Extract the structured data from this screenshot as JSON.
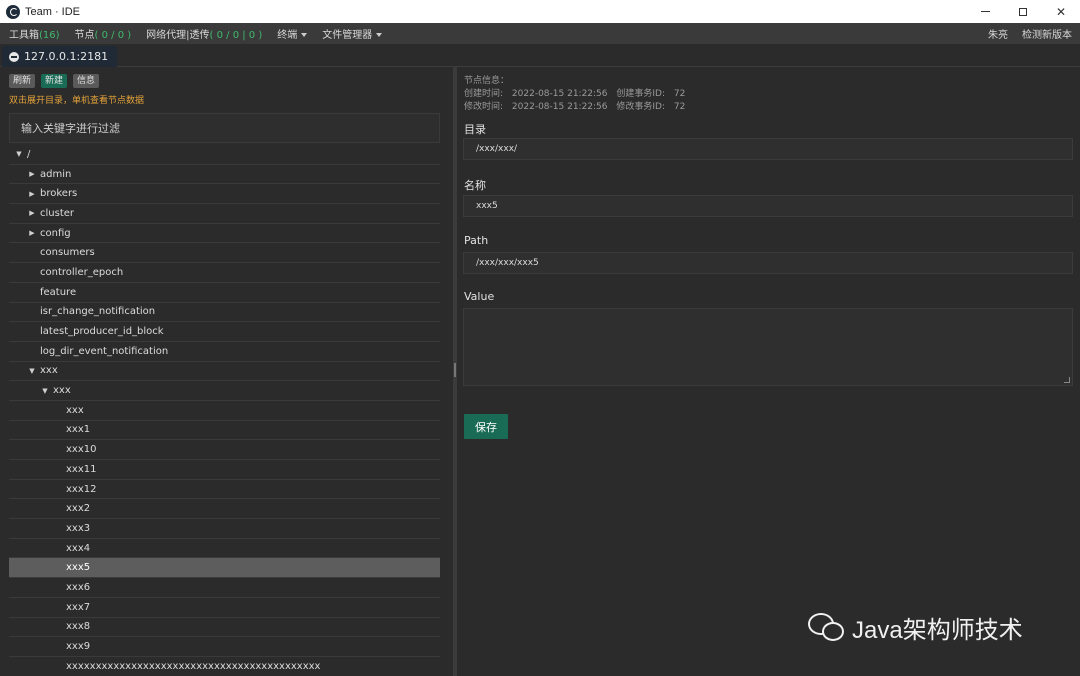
{
  "window": {
    "title": "Team · IDE"
  },
  "menu": {
    "toolbox_label": "工具箱",
    "toolbox_count": "(16)",
    "nodes_label": "节点",
    "nodes_count": "( 0 / 0 )",
    "proxy_label": "网络代理|透传",
    "proxy_count": "( 0 / 0 | 0 )",
    "terminal_label": "终端",
    "file_manager_label": "文件管理器",
    "user_label": "朱亮",
    "check_update_label": "检测新版本"
  },
  "tab": {
    "label": "127.0.0.1:2181"
  },
  "left": {
    "buttons": {
      "refresh": "刷新",
      "new": "新建",
      "info": "信息"
    },
    "hint": "双击展开目录，单机查看节点数据",
    "filter_placeholder": "输入关键字进行过滤",
    "tree": [
      {
        "label": "/",
        "depth": 0,
        "state": "expanded",
        "selected": false
      },
      {
        "label": "admin",
        "depth": 1,
        "state": "collapsed",
        "selected": false
      },
      {
        "label": "brokers",
        "depth": 1,
        "state": "collapsed",
        "selected": false
      },
      {
        "label": "cluster",
        "depth": 1,
        "state": "collapsed",
        "selected": false
      },
      {
        "label": "config",
        "depth": 1,
        "state": "collapsed",
        "selected": false
      },
      {
        "label": "consumers",
        "depth": 1,
        "state": "leaf",
        "selected": false
      },
      {
        "label": "controller_epoch",
        "depth": 1,
        "state": "leaf",
        "selected": false
      },
      {
        "label": "feature",
        "depth": 1,
        "state": "leaf",
        "selected": false
      },
      {
        "label": "isr_change_notification",
        "depth": 1,
        "state": "leaf",
        "selected": false
      },
      {
        "label": "latest_producer_id_block",
        "depth": 1,
        "state": "leaf",
        "selected": false
      },
      {
        "label": "log_dir_event_notification",
        "depth": 1,
        "state": "leaf",
        "selected": false
      },
      {
        "label": "xxx",
        "depth": 1,
        "state": "expanded",
        "selected": false
      },
      {
        "label": "xxx",
        "depth": 2,
        "state": "expanded",
        "selected": false
      },
      {
        "label": "xxx",
        "depth": 3,
        "state": "leaf",
        "selected": false
      },
      {
        "label": "xxx1",
        "depth": 3,
        "state": "leaf",
        "selected": false
      },
      {
        "label": "xxx10",
        "depth": 3,
        "state": "leaf",
        "selected": false
      },
      {
        "label": "xxx11",
        "depth": 3,
        "state": "leaf",
        "selected": false
      },
      {
        "label": "xxx12",
        "depth": 3,
        "state": "leaf",
        "selected": false
      },
      {
        "label": "xxx2",
        "depth": 3,
        "state": "leaf",
        "selected": false
      },
      {
        "label": "xxx3",
        "depth": 3,
        "state": "leaf",
        "selected": false
      },
      {
        "label": "xxx4",
        "depth": 3,
        "state": "leaf",
        "selected": false
      },
      {
        "label": "xxx5",
        "depth": 3,
        "state": "leaf",
        "selected": true
      },
      {
        "label": "xxx6",
        "depth": 3,
        "state": "leaf",
        "selected": false
      },
      {
        "label": "xxx7",
        "depth": 3,
        "state": "leaf",
        "selected": false
      },
      {
        "label": "xxx8",
        "depth": 3,
        "state": "leaf",
        "selected": false
      },
      {
        "label": "xxx9",
        "depth": 3,
        "state": "leaf",
        "selected": false
      },
      {
        "label": "xxxxxxxxxxxxxxxxxxxxxxxxxxxxxxxxxxxxxxxxxxx",
        "depth": 3,
        "state": "leaf",
        "selected": false
      }
    ]
  },
  "right": {
    "info_title": "节点信息：",
    "created_time_label": "创建时间:",
    "created_time": "2022-08-15 21:22:56",
    "created_txid_label": "创建事务ID:",
    "created_txid": "72",
    "modified_time_label": "修改时间:",
    "modified_time": "2022-08-15 21:22:56",
    "modified_txid_label": "修改事务ID:",
    "modified_txid": "72",
    "dir_label": "目录",
    "dir_value": "/xxx/xxx/",
    "name_label": "名称",
    "name_value": "xxx5",
    "path_label": "Path",
    "path_value": "/xxx/xxx/xxx5",
    "value_label": "Value",
    "value_value": "",
    "save_label": "保存"
  },
  "watermark": {
    "text": "Java架构师技术"
  }
}
